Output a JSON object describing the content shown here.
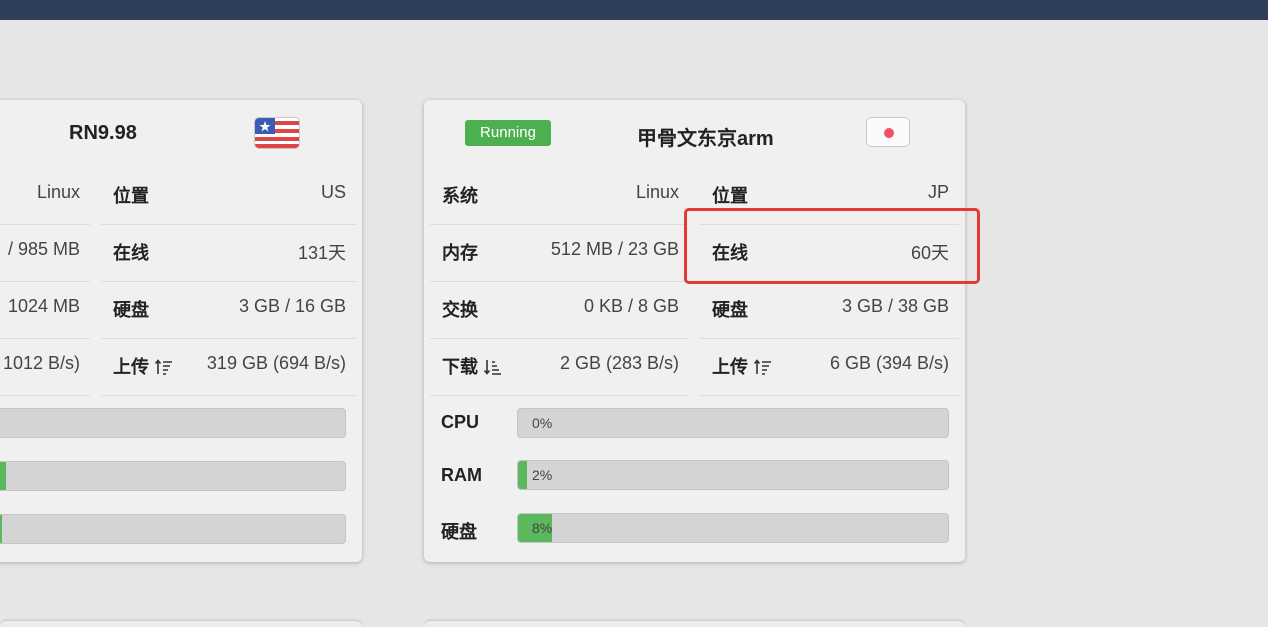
{
  "card_left": {
    "title": "RN9.98",
    "flag": "us-flag-icon",
    "rows": [
      {
        "left_value": "Linux",
        "label": "位置",
        "value": "US"
      },
      {
        "left_value": "/ 985 MB",
        "label": "在线",
        "value": "131天"
      },
      {
        "left_value": "1024 MB",
        "label": "硬盘",
        "value": "3 GB / 16 GB"
      },
      {
        "left_value": "1012 B/s)",
        "label": "上传",
        "value": "319 GB (694 B/s)"
      }
    ],
    "bars": [
      {
        "fraction": 0.0
      },
      {
        "fraction": 0.02
      },
      {
        "fraction": 0.01
      }
    ]
  },
  "card_right": {
    "status": "Running",
    "status_color": "#4caf50",
    "title": "甲骨文东京arm",
    "rows": [
      {
        "label": "系统",
        "value": "Linux"
      },
      {
        "label": "位置",
        "value": "JP"
      },
      {
        "label": "内存",
        "value": "512 MB / 23 GB"
      },
      {
        "label": "在线",
        "value": "60天"
      },
      {
        "label": "交换",
        "value": "0 KB / 8 GB"
      },
      {
        "label": "硬盘",
        "value": "3 GB / 38 GB"
      },
      {
        "label": "下载",
        "value": "2 GB (283 B/s)"
      },
      {
        "label": "上传",
        "value": "6 GB (394 B/s)"
      }
    ],
    "bars": [
      {
        "label": "CPU",
        "percent_text": "0%",
        "fraction": 0.0
      },
      {
        "label": "RAM",
        "percent_text": "2%",
        "fraction": 0.02
      },
      {
        "label": "硬盘",
        "percent_text": "8%",
        "fraction": 0.08
      }
    ]
  },
  "colors": {
    "accent_green": "#5cb85c",
    "highlight_red": "#e53935",
    "header_bar": "#2f3e5a",
    "record_dot": "#ef5063"
  }
}
